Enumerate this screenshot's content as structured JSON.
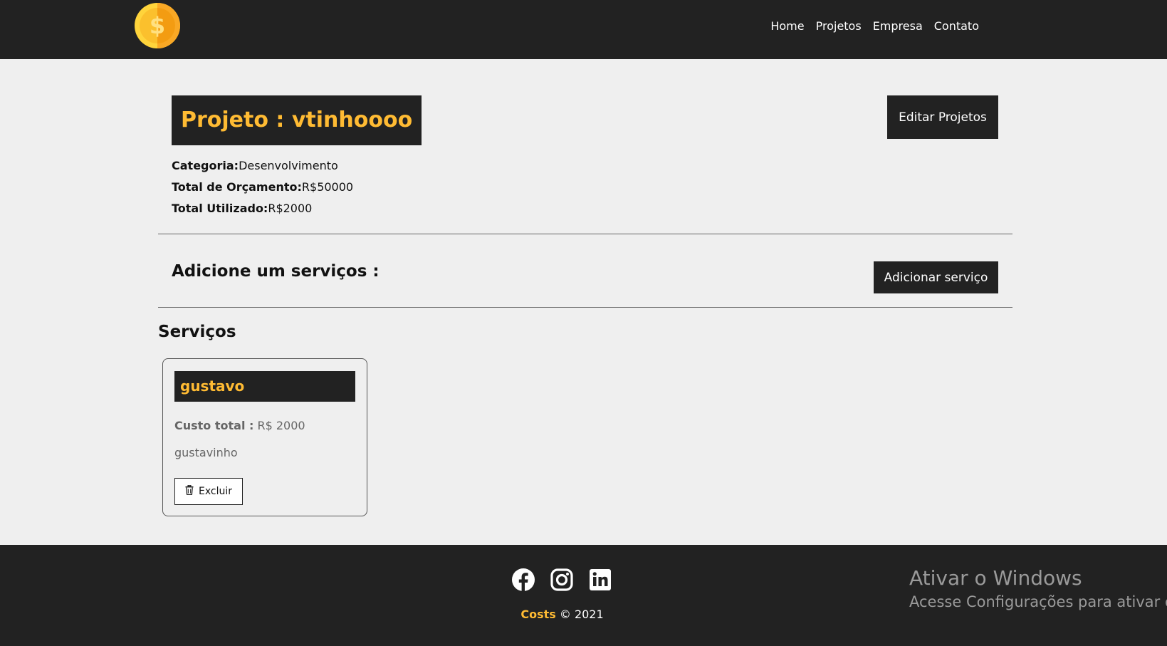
{
  "navbar": {
    "logo_icon": "dollar-coin-icon",
    "links": [
      "Home",
      "Projetos",
      "Empresa",
      "Contato"
    ]
  },
  "project": {
    "title": "Projeto : vtinhoooo",
    "edit_button": "Editar Projetos",
    "category_label": "Categoria:",
    "category_value": "Desenvolvimento",
    "budget_label": "Total de Orçamento:",
    "budget_value": "R$50000",
    "used_label": "Total Utilizado:",
    "used_value": "R$2000"
  },
  "add_service": {
    "title": "Adicione um serviços :",
    "button": "Adicionar serviço"
  },
  "services": {
    "title": "Serviços",
    "items": [
      {
        "name": "gustavo",
        "cost_label": "Custo total :",
        "cost_value": " R$ 2000",
        "description": "gustavinho",
        "delete_label": "Excluir",
        "delete_icon": "trash-icon"
      }
    ]
  },
  "footer": {
    "social_icons": [
      "facebook-icon",
      "instagram-icon",
      "linkedin-icon"
    ],
    "brand": "Costs",
    "copyright": " © 2021"
  },
  "watermark": {
    "line1": "Ativar o Windows",
    "line2": "Acesse Configurações para ativar o W"
  },
  "colors": {
    "dark": "#222222",
    "accent": "#ffbb33",
    "background": "#efefef"
  }
}
